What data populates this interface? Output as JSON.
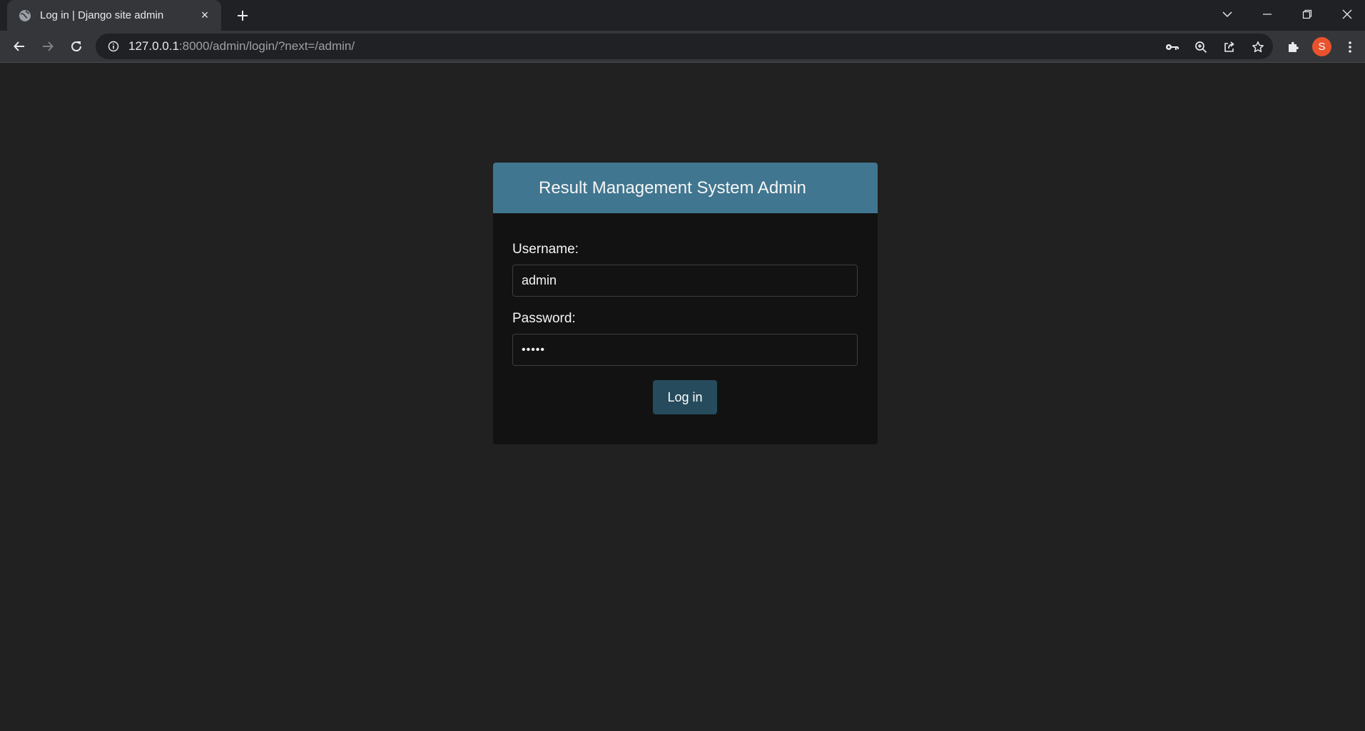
{
  "browser": {
    "tab": {
      "title": "Log in | Django site admin",
      "favicon": "globe-icon",
      "close": "×"
    },
    "address_bar": {
      "host": "127.0.0.1",
      "rest": ":8000/admin/login/?next=/admin/"
    },
    "profile_initial": "S",
    "profile_color": "#e8532e"
  },
  "login": {
    "header_title": "Result Management System Admin",
    "username_label": "Username:",
    "username_value": "admin",
    "password_label": "Password:",
    "password_value": "•••••",
    "submit_label": "Log in"
  },
  "colors": {
    "page_background": "#212121",
    "header_blue": "#417690",
    "button_blue": "#264b5d",
    "panel": "#121212"
  }
}
